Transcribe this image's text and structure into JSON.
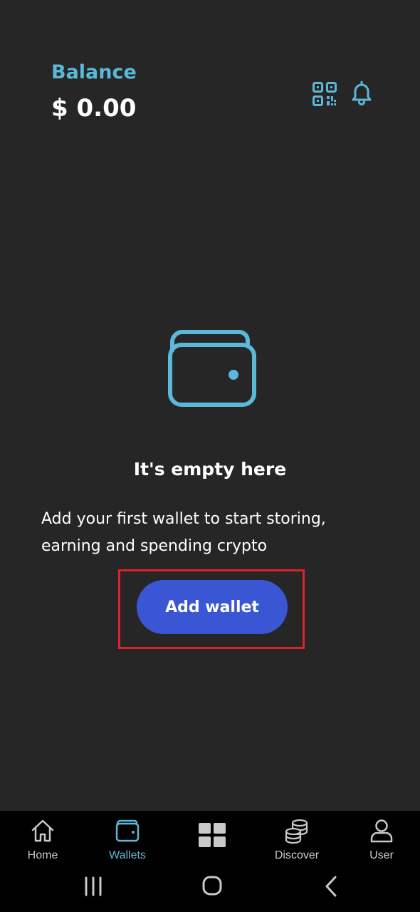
{
  "header": {
    "balance_label": "Balance",
    "balance_value": "$ 0.00",
    "qr_icon": "qr-code-icon",
    "bell_icon": "bell-icon"
  },
  "empty_state": {
    "icon": "wallet-icon",
    "title": "It's empty here",
    "description": "Add your first wallet to start storing, earning and spending crypto",
    "button_label": "Add wallet"
  },
  "bottom_nav": {
    "items": [
      {
        "label": "Home",
        "icon": "home-icon"
      },
      {
        "label": "Wallets",
        "icon": "wallet-icon",
        "active": true
      },
      {
        "label": "",
        "icon": "grid-icon"
      },
      {
        "label": "Discover",
        "icon": "coins-icon"
      },
      {
        "label": "User",
        "icon": "user-icon"
      }
    ]
  },
  "colors": {
    "background": "#262626",
    "accent": "#5bb8d9",
    "button": "#3a56d4",
    "highlight": "#e0202a",
    "nav_background": "#000000"
  }
}
